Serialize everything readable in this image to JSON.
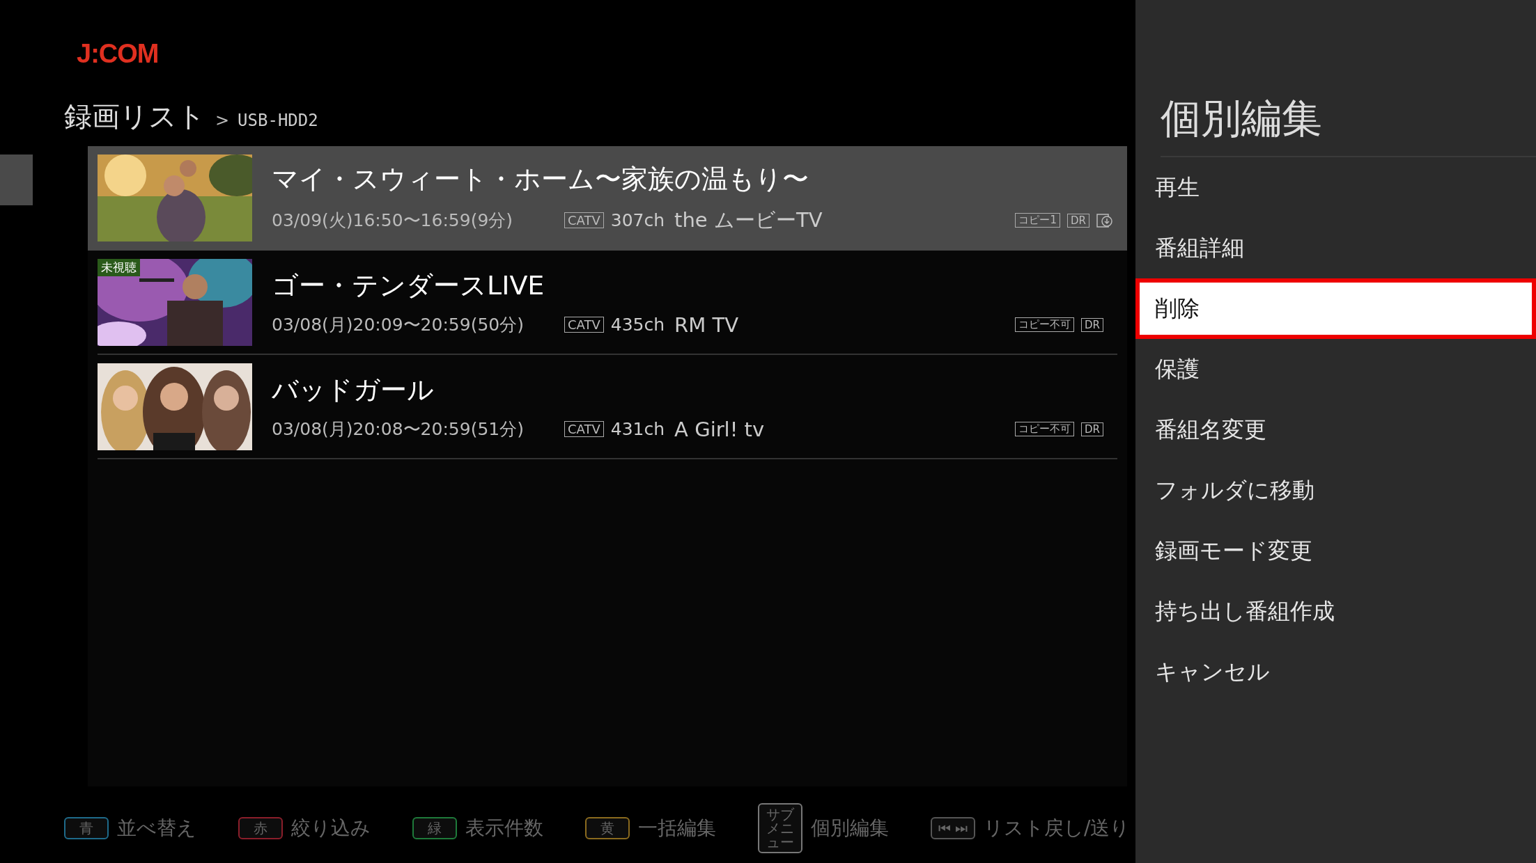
{
  "logo": "J:COM",
  "breadcrumb": {
    "title": "録画リスト",
    "separator": ">",
    "location": "USB-HDD2"
  },
  "recordings": [
    {
      "title": "マイ・スウィート・ホーム〜家族の温もり〜",
      "time": "03/09(火)16:50〜16:59(9分)",
      "network": "CATV",
      "channel": "307ch",
      "station": "the ムービーTV",
      "badges": [
        "コピー1",
        "DR"
      ],
      "download": true,
      "selected": true
    },
    {
      "title": "ゴー・テンダースLIVE",
      "time": "03/08(月)20:09〜20:59(50分)",
      "network": "CATV",
      "channel": "435ch",
      "station": "RM TV",
      "badges": [
        "コピー不可",
        "DR"
      ],
      "download": false,
      "unwatched": "未視聴",
      "selected": false
    },
    {
      "title": "バッドガール",
      "time": "03/08(月)20:08〜20:59(51分)",
      "network": "CATV",
      "channel": "431ch",
      "station": "A Girl! tv",
      "badges": [
        "コピー不可",
        "DR"
      ],
      "download": false,
      "selected": false
    }
  ],
  "footer": [
    {
      "key": "青",
      "color": "#1e6a8a",
      "label": "並べ替え"
    },
    {
      "key": "赤",
      "color": "#8a1e2a",
      "label": "絞り込み"
    },
    {
      "key": "緑",
      "color": "#1e7a3a",
      "label": "表示件数"
    },
    {
      "key": "黄",
      "color": "#8a6a1e",
      "label": "一括編集"
    },
    {
      "key": "サブメニュー",
      "color": "#777777",
      "label": "個別編集"
    },
    {
      "key": "⏮ ⏭",
      "color": "#555555",
      "label": "リスト戻し/送り"
    }
  ],
  "menu": {
    "title": "個別編集",
    "items": [
      {
        "label": "再生",
        "selected": false
      },
      {
        "label": "番組詳細",
        "selected": false
      },
      {
        "label": "削除",
        "selected": true
      },
      {
        "label": "保護",
        "selected": false
      },
      {
        "label": "番組名変更",
        "selected": false
      },
      {
        "label": "フォルダに移動",
        "selected": false
      },
      {
        "label": "録画モード変更",
        "selected": false
      },
      {
        "label": "持ち出し番組作成",
        "selected": false
      },
      {
        "label": "キャンセル",
        "selected": false
      }
    ]
  }
}
